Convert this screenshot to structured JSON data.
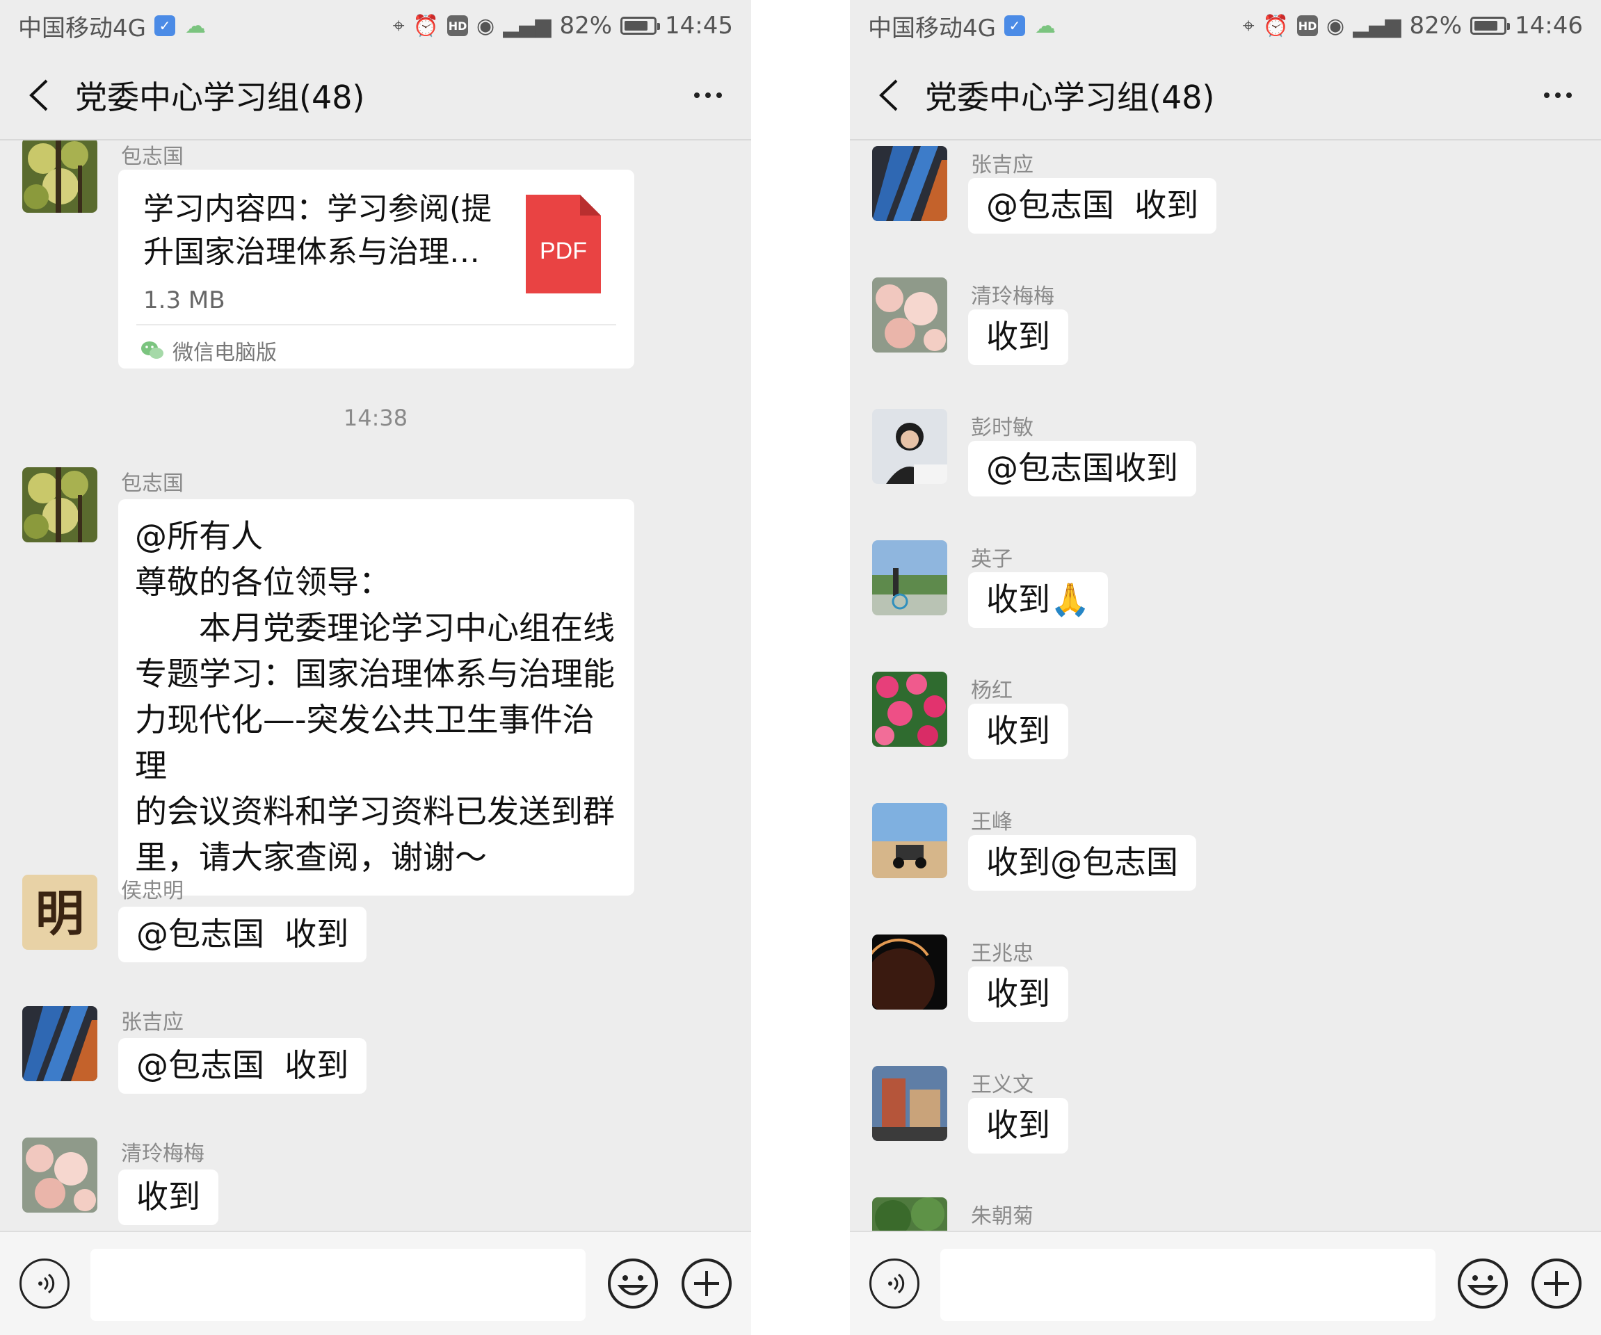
{
  "screens": [
    {
      "status": {
        "carrier": "中国移动4G",
        "battery": "82%",
        "battery_level": 0.82,
        "time": "14:45"
      },
      "title": "党委中心学习组(48)",
      "file_message": {
        "sender": "包志国",
        "file_name": "学习内容四：学习参阅(提升国家治理体系与治理…",
        "file_size": "1.3 MB",
        "file_type": "PDF",
        "source": "微信电脑版"
      },
      "timestamp": "14:38",
      "long_message": {
        "sender": "包志国",
        "lines": [
          "@所有人",
          "尊敬的各位领导：",
          "　　本月党委理论学习中心组在线",
          "专题学习：国家治理体系与治理能",
          "力现代化—-突发公共卫生事件治理",
          "的会议资料和学习资料已发送到群",
          "里，请大家查阅，谢谢～"
        ]
      },
      "messages": [
        {
          "sender": "侯忠明",
          "text": "@包志国  收到",
          "avatar": "calligraphy-avatar"
        },
        {
          "sender": "张吉应",
          "text": "@包志国  收到",
          "avatar": "feather-avatar"
        },
        {
          "sender": "清玲梅梅",
          "text": "收到",
          "avatar": "blossom-avatar"
        }
      ]
    },
    {
      "status": {
        "carrier": "中国移动4G",
        "battery": "82%",
        "battery_level": 0.82,
        "time": "14:46"
      },
      "title": "党委中心学习组(48)",
      "messages": [
        {
          "sender": "张吉应",
          "text": "@包志国  收到",
          "avatar": "feather-avatar"
        },
        {
          "sender": "清玲梅梅",
          "text": "收到",
          "avatar": "blossom-avatar"
        },
        {
          "sender": "彭时敏",
          "text": "@包志国收到",
          "avatar": "portrait-avatar"
        },
        {
          "sender": "英子",
          "text": "收到",
          "emoji": "🙏",
          "avatar": "landscape-avatar"
        },
        {
          "sender": "杨红",
          "text": "收到",
          "avatar": "flowers-avatar"
        },
        {
          "sender": "王峰",
          "text": "收到@包志国",
          "avatar": "desert-avatar"
        },
        {
          "sender": "王兆忠",
          "text": "收到",
          "avatar": "planet-avatar"
        },
        {
          "sender": "王义文",
          "text": "收到",
          "avatar": "building-avatar"
        },
        {
          "sender": "朱朝菊",
          "text": "",
          "avatar": "trees-avatar"
        }
      ]
    }
  ],
  "colors": {
    "chat_bg": "#ededed",
    "bubble_bg": "#ffffff",
    "pdf_red": "#e94343",
    "sender_gray": "#8a8a8a"
  }
}
